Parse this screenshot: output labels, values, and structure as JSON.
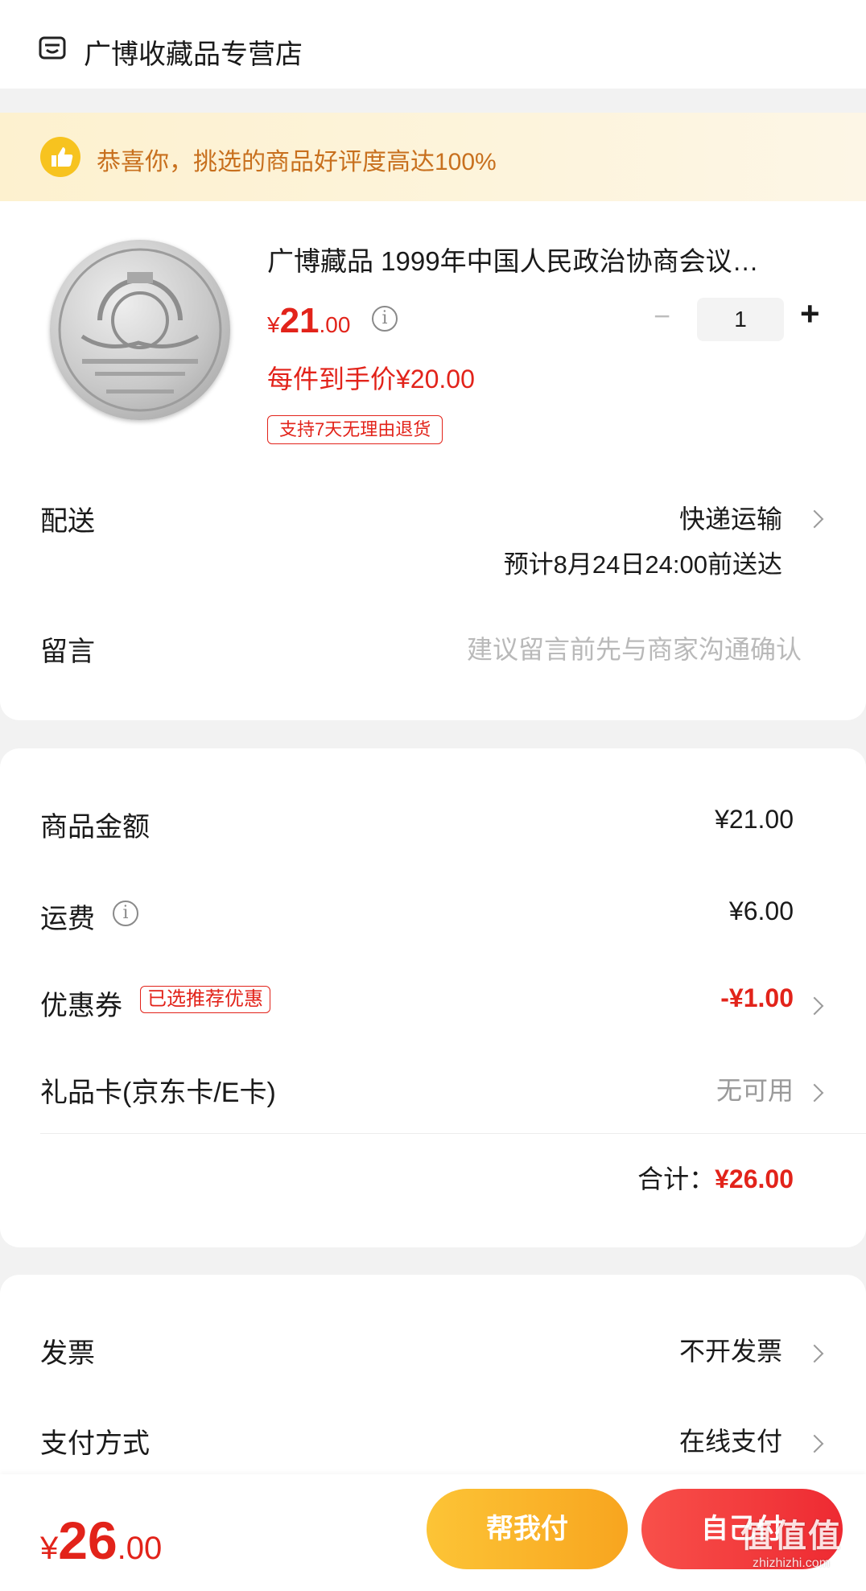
{
  "store": {
    "icon": "store-icon",
    "name": "广博收藏品专营店"
  },
  "banner": {
    "icon": "thumbs-up-icon",
    "text": "恭喜你，挑选的商品好评度高达100%"
  },
  "product": {
    "image": "coin-image",
    "title": "广博藏品 1999年中国人民政治协商会议…",
    "price_symbol": "¥",
    "price_int": "21",
    "price_dec": ".00",
    "unit_price_text": "每件到手价¥20.00",
    "return_badge": "支持7天无理由退货",
    "quantity": "1",
    "minus": "−",
    "plus": "+"
  },
  "delivery": {
    "label": "配送",
    "method": "快递运输",
    "eta": "预计8月24日24:00前送达"
  },
  "message": {
    "label": "留言",
    "placeholder": "建议留言前先与商家沟通确认"
  },
  "summary": {
    "goods_label": "商品金额",
    "goods_value": "¥21.00",
    "shipping_label": "运费",
    "shipping_value": "¥6.00",
    "coupon_label": "优惠券",
    "coupon_badge": "已选推荐优惠",
    "coupon_value": "-¥1.00",
    "giftcard_label": "礼品卡(京东卡/E卡)",
    "giftcard_value": "无可用",
    "total_label": "合计：",
    "total_value": "¥26.00"
  },
  "invoice": {
    "label": "发票",
    "value": "不开发票"
  },
  "payment": {
    "label": "支付方式",
    "value": "在线支付"
  },
  "footer": {
    "price_symbol": "¥",
    "price_int": "26",
    "price_dec": ".00",
    "help_pay_label": "帮我付",
    "self_pay_label": "自己付"
  },
  "watermark": {
    "text": "值值值",
    "sub": "zhizhizhi.com"
  },
  "colors": {
    "accent_red": "#e2231a",
    "banner_bg": "#fdf3d3",
    "banner_text": "#c8701e",
    "help_pay": "#fbb52a",
    "self_pay": "#f23b3b"
  }
}
